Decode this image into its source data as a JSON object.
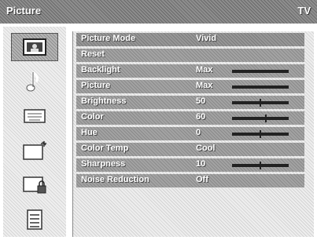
{
  "header": {
    "title": "Picture",
    "source": "TV"
  },
  "sidebar": {
    "items": [
      {
        "icon": "picture-icon",
        "selected": true
      },
      {
        "icon": "music-note-icon",
        "selected": false
      },
      {
        "icon": "keyboard-icon",
        "selected": false
      },
      {
        "icon": "setup-window-icon",
        "selected": false
      },
      {
        "icon": "lock-window-icon",
        "selected": false
      },
      {
        "icon": "list-icon",
        "selected": false
      }
    ]
  },
  "menu": {
    "rows": [
      {
        "label": "Picture Mode",
        "value": "Vivid",
        "slider": null
      },
      {
        "label": "Reset",
        "value": "",
        "slider": null
      },
      {
        "label": "Backlight",
        "value": "Max",
        "slider": {
          "level": 1.0,
          "center_mark": false
        }
      },
      {
        "label": "Picture",
        "value": "Max",
        "slider": {
          "level": 1.0,
          "center_mark": false
        }
      },
      {
        "label": "Brightness",
        "value": "50",
        "slider": {
          "level": 0.5,
          "center_mark": true
        }
      },
      {
        "label": "Color",
        "value": "60",
        "slider": {
          "level": 0.6,
          "center_mark": true
        }
      },
      {
        "label": "Hue",
        "value": "0",
        "slider": {
          "level": 0.5,
          "center_mark": true
        }
      },
      {
        "label": "Color Temp",
        "value": "Cool",
        "slider": null
      },
      {
        "label": "Sharpness",
        "value": "10",
        "slider": {
          "level": 0.5,
          "center_mark": true
        }
      },
      {
        "label": "Noise Reduction",
        "value": "Off",
        "slider": null
      }
    ]
  }
}
